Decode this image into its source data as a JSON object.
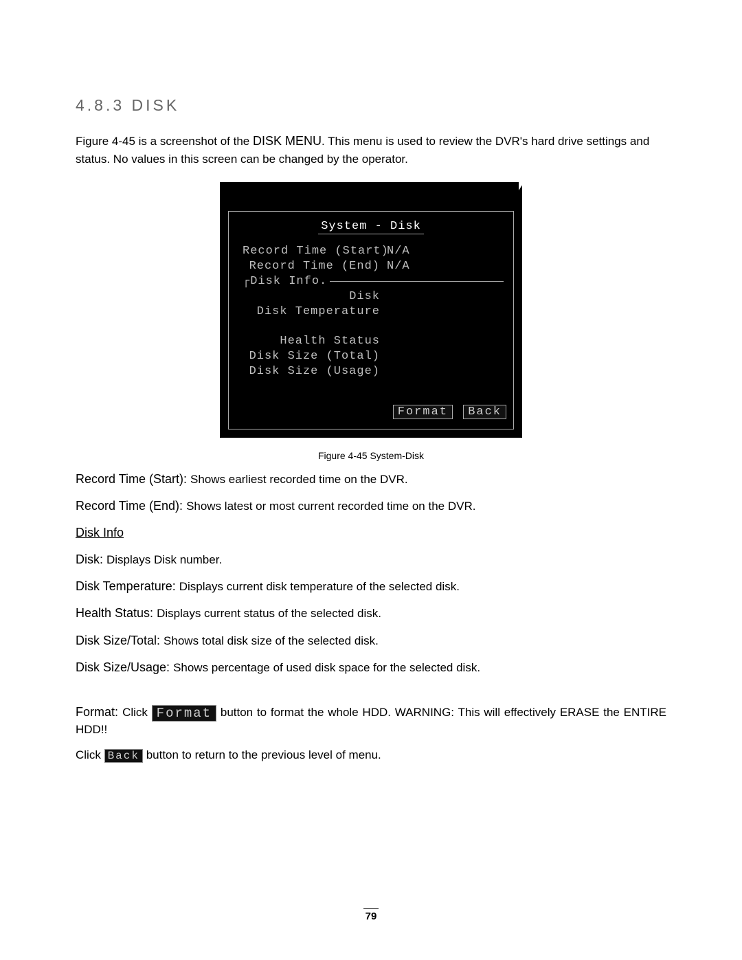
{
  "heading": "4.8.3  DISK",
  "intro_parts": {
    "p1": "Figure 4-45 is a screenshot of the ",
    "p2": "DISK MENU",
    "p3": ". This menu is used to review the DVR's hard drive settings and status. No values in this screen can be changed by the operator."
  },
  "menu": {
    "title": "System - Disk",
    "record_start_label": "Record Time (Start)",
    "record_start_value": "N/A",
    "record_end_label": "Record Time (End)",
    "record_end_value": "N/A",
    "disk_info_label": "Disk Info.",
    "disk_label": "Disk",
    "disk_temp_label": "Disk Temperature",
    "health_label": "Health Status",
    "size_total_label": "Disk Size (Total)",
    "size_usage_label": "Disk Size (Usage)",
    "format_btn": "Format",
    "back_btn": "Back"
  },
  "caption": "Figure 4-45 System-Disk",
  "defs": {
    "rec_start": {
      "lead": "Record Time (Start): ",
      "body": "Shows earliest recorded time on the DVR."
    },
    "rec_end": {
      "lead": "Record Time (End): ",
      "body": "Shows latest or most current recorded time on the DVR."
    },
    "disk_info_hdr": "Disk Info",
    "disk": {
      "lead": "Disk: ",
      "body": "Displays Disk number."
    },
    "disk_temp": {
      "lead": "Disk Temperature: ",
      "body": "Displays current disk temperature of the selected disk."
    },
    "health": {
      "lead": "Health Status: ",
      "body": "Displays current status of the selected disk."
    },
    "size_total": {
      "lead": "Disk Size/Total: ",
      "body": "Shows total disk size of the selected disk."
    },
    "size_usage": {
      "lead": "Disk Size/Usage: ",
      "body": "Shows percentage of used disk space for the selected disk."
    },
    "format": {
      "lead": "Format: ",
      "pre": "Click ",
      "btn": "Format",
      "post": " button to format the whole HDD. WARNING: This will effectively ERASE the ENTIRE HDD!!"
    },
    "back": {
      "pre": "Click ",
      "btn": "Back",
      "post": " button to return to the previous level of menu."
    }
  },
  "page_number": "79"
}
